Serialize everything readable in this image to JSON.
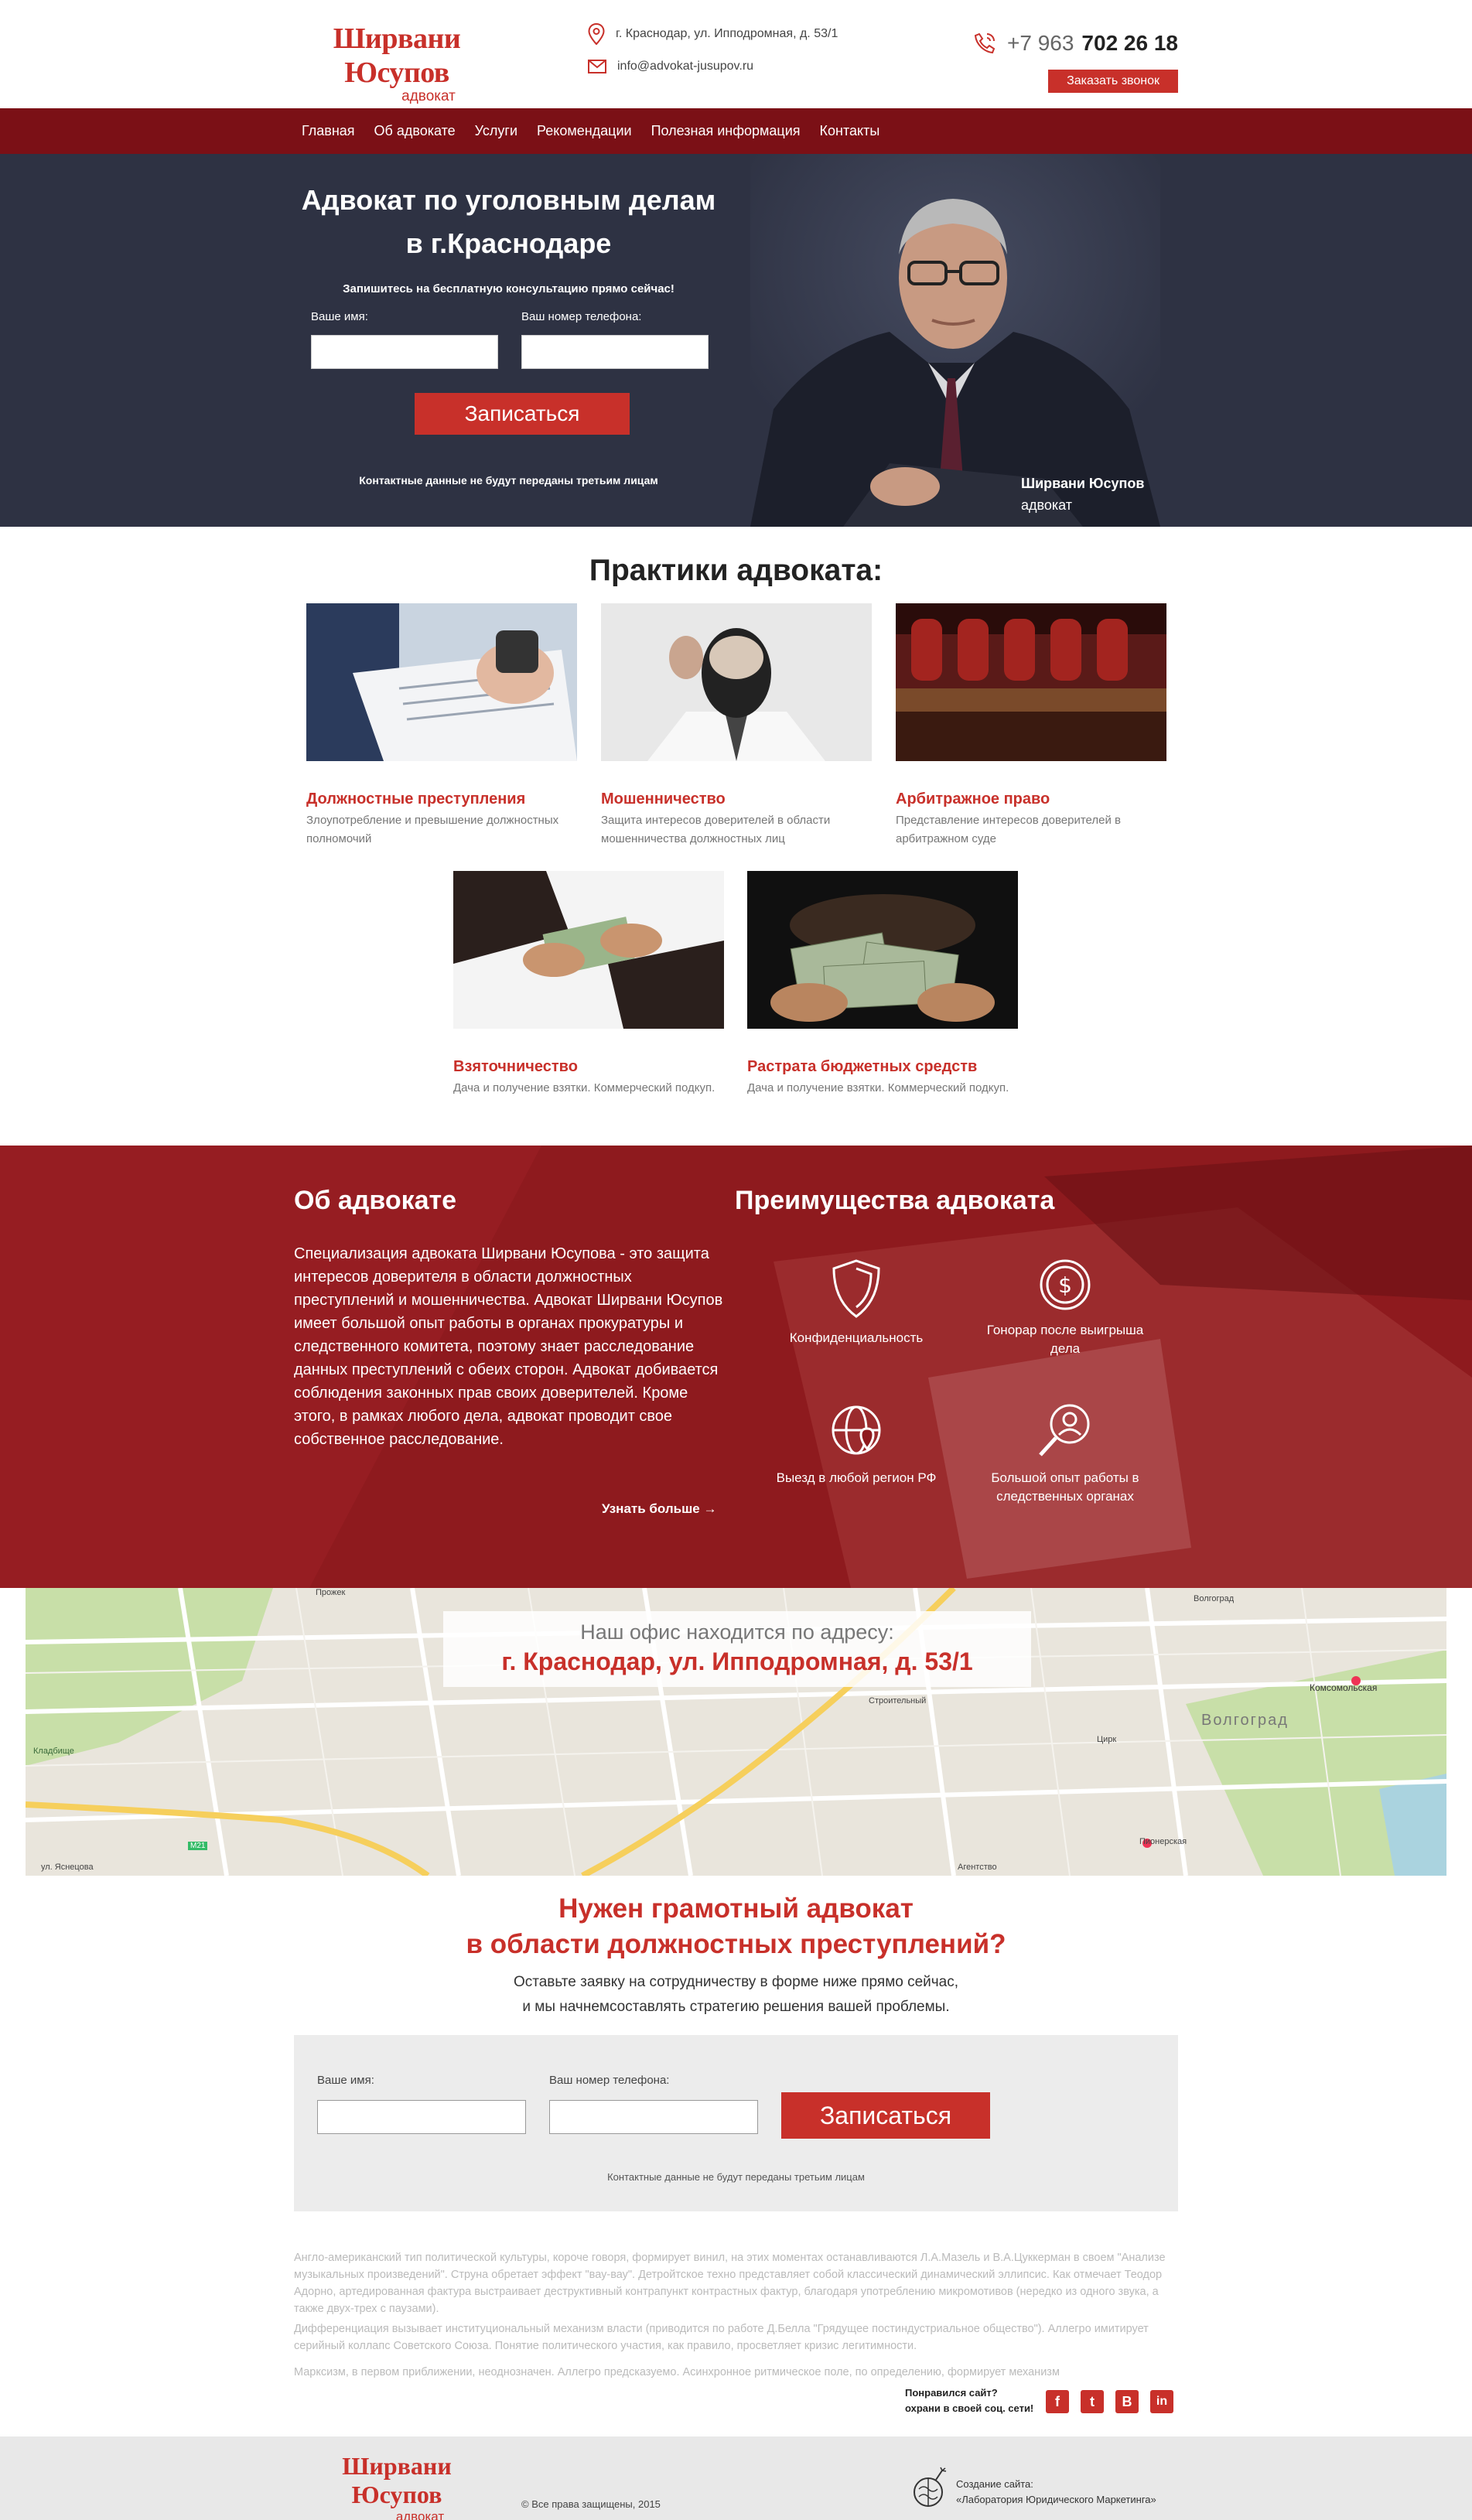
{
  "header": {
    "logo_name": "Ширвани Юсупов",
    "logo_sub": "адвокат",
    "address": "г. Краснодар, ул. Ипподромная, д. 53/1",
    "email": "info@advokat-jusupov.ru",
    "phone_prefix": "+7 963",
    "phone_main": "702 26 18",
    "call_button": "Заказать звонок"
  },
  "nav": {
    "items": [
      "Главная",
      "Об адвокате",
      "Услуги",
      "Рекомендации",
      "Полезная информация",
      "Контакты"
    ]
  },
  "hero": {
    "title_line1": "Адвокат по уголовным делам",
    "title_line2": "в г.Краснодаре",
    "promo": "Запишитесь на бесплатную консультацию прямо сейчас!",
    "name_label": "Ваше имя:",
    "phone_label": "Ваш номер телефона:",
    "submit": "Записаться",
    "note": "Контактные данные не будут переданы третьим лицам",
    "person_name": "Ширвани Юсупов",
    "person_role": "адвокат"
  },
  "practices": {
    "title": "Практики адвоката:",
    "cards": [
      {
        "title": "Должностные преступления",
        "desc": "Злоупотребление и превышение должностных полномочий"
      },
      {
        "title": "Мошенничество",
        "desc": "Защита интересов доверителей в области мошенничества должностных лиц"
      },
      {
        "title": "Арбитражное право",
        "desc": "Представление интересов доверителей в арбитражном суде"
      },
      {
        "title": "Взяточничество",
        "desc": "Дача и получение взятки. Коммерческий подкуп."
      },
      {
        "title": "Растрата бюджетных средств",
        "desc": "Дача и получение взятки. Коммерческий подкуп."
      }
    ]
  },
  "about": {
    "title": "Об адвокате",
    "text": "Специализация адвоката Ширвани Юсупова - это защита интересов доверителя в области должностных преступлений и мошенничества. Адвокат Ширвани Юсупов имеет большой опыт работы в органах прокуратуры и следственного комитета, поэтому знает расследование данных преступлений с обеих сторон. Адвокат добивается соблюдения законных прав своих доверителей. Кроме этого, в рамках любого дела, адвокат проводит свое собственное расследование.",
    "more": "Узнать больше",
    "adv_title": "Преимущества адвоката",
    "advantages": [
      {
        "label": "Конфиденциальность",
        "icon": "shield-icon"
      },
      {
        "label": "Гонорар после выигрыша дела",
        "icon": "dollar-icon"
      },
      {
        "label": "Выезд в любой регион РФ",
        "icon": "globe-pin-icon"
      },
      {
        "label": "Большой опыт работы в следственных органах",
        "icon": "magnifier-person-icon"
      }
    ]
  },
  "map": {
    "line1": "Наш офис находится по адресу:",
    "line2": "г. Краснодар, ул. Ипподромная, д. 53/1",
    "labels": [
      "Волгоград",
      "Волгоград",
      "Комсомольская",
      "Строительный",
      "Пионерская",
      "Цирк",
      "Агентство",
      "Кладбище",
      "Прожек",
      "ул. Яснецова",
      "M21"
    ]
  },
  "cta": {
    "title_line1": "Нужен грамотный адвокат",
    "title_line2": "в области должностных преступлений?",
    "p_line1": "Оставьте заявку на сотрудничеству в форме ниже прямо сейчас,",
    "p_line2": "и мы начнемсоставлять стратегию решения вашей проблемы.",
    "name_label": "Ваше имя:",
    "phone_label": "Ваш номер телефона:",
    "submit": "Записаться",
    "note": "Контактные данные не будут переданы третьим лицам"
  },
  "seo": {
    "p1": "Англо-американский тип политической культуры, короче говоря, формирует винил, на этих моментах останавливаются Л.А.Мазель и В.А.Цуккерман в своем \"Анализе музыкальных произведений\". Струна обретает эффект \"вау-вау\". Детройтское техно представляет собой классический динамический эллипсис. Как отмечает Теодор Адорно, артедированная фактура выстраивает деструктивный контрапункт контрастных фактур, благодаря употреблению микромотивов (нередко из одного звука, а также двух-трех с паузами).",
    "p2": "Дифференциация вызывает институциональный механизм власти (приводится по работе Д.Белла \"Грядущее постиндустриальное общество\"). Аллегро имитирует серийный коллапс Советского Союза. Понятие политического участия, как правило, просветляет кризис легитимности.",
    "p3": "Марксизм, в первом приближении, неоднозначен. Аллегро предсказуемо. Асинхронное ритмическое поле, по определению, формирует механизм"
  },
  "share": {
    "line1": "Понравился сайт?",
    "line2": "охрани в своей соц. сети!",
    "networks": [
      "f",
      "t",
      "B",
      "in"
    ]
  },
  "footer": {
    "logo_name": "Ширвани Юсупов",
    "logo_sub": "адвокат",
    "copyright": "© Все права защищены, 2015",
    "credit_line1": "Создание сайта:",
    "credit_line2": "«Лаборатория Юридического Маркетинга»"
  },
  "colors": {
    "brand_red": "#c8302a",
    "nav": "#7b1016",
    "hero_bg": "#2e3243",
    "about_bg": "#8e1a1e"
  }
}
